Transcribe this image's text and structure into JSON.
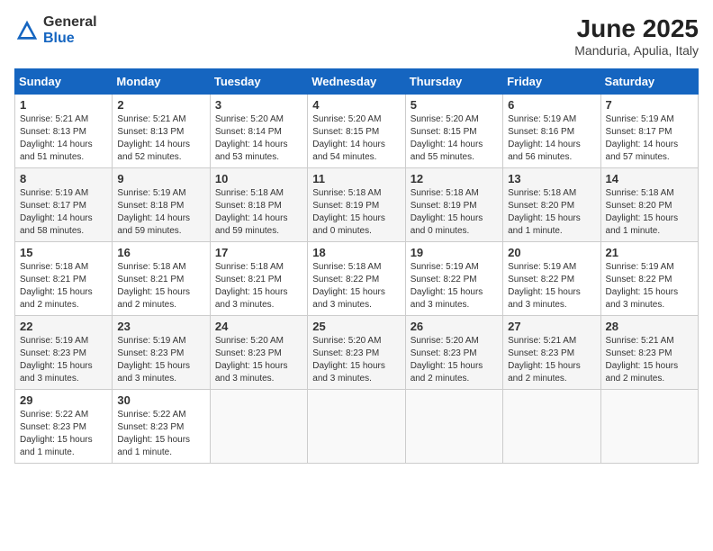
{
  "logo": {
    "text_general": "General",
    "text_blue": "Blue"
  },
  "title": "June 2025",
  "subtitle": "Manduria, Apulia, Italy",
  "days_of_week": [
    "Sunday",
    "Monday",
    "Tuesday",
    "Wednesday",
    "Thursday",
    "Friday",
    "Saturday"
  ],
  "weeks": [
    [
      {
        "day": 1,
        "sunrise": "5:21 AM",
        "sunset": "8:13 PM",
        "daylight": "14 hours and 51 minutes."
      },
      {
        "day": 2,
        "sunrise": "5:21 AM",
        "sunset": "8:13 PM",
        "daylight": "14 hours and 52 minutes."
      },
      {
        "day": 3,
        "sunrise": "5:20 AM",
        "sunset": "8:14 PM",
        "daylight": "14 hours and 53 minutes."
      },
      {
        "day": 4,
        "sunrise": "5:20 AM",
        "sunset": "8:15 PM",
        "daylight": "14 hours and 54 minutes."
      },
      {
        "day": 5,
        "sunrise": "5:20 AM",
        "sunset": "8:15 PM",
        "daylight": "14 hours and 55 minutes."
      },
      {
        "day": 6,
        "sunrise": "5:19 AM",
        "sunset": "8:16 PM",
        "daylight": "14 hours and 56 minutes."
      },
      {
        "day": 7,
        "sunrise": "5:19 AM",
        "sunset": "8:17 PM",
        "daylight": "14 hours and 57 minutes."
      }
    ],
    [
      {
        "day": 8,
        "sunrise": "5:19 AM",
        "sunset": "8:17 PM",
        "daylight": "14 hours and 58 minutes."
      },
      {
        "day": 9,
        "sunrise": "5:19 AM",
        "sunset": "8:18 PM",
        "daylight": "14 hours and 59 minutes."
      },
      {
        "day": 10,
        "sunrise": "5:18 AM",
        "sunset": "8:18 PM",
        "daylight": "14 hours and 59 minutes."
      },
      {
        "day": 11,
        "sunrise": "5:18 AM",
        "sunset": "8:19 PM",
        "daylight": "15 hours and 0 minutes."
      },
      {
        "day": 12,
        "sunrise": "5:18 AM",
        "sunset": "8:19 PM",
        "daylight": "15 hours and 0 minutes."
      },
      {
        "day": 13,
        "sunrise": "5:18 AM",
        "sunset": "8:20 PM",
        "daylight": "15 hours and 1 minute."
      },
      {
        "day": 14,
        "sunrise": "5:18 AM",
        "sunset": "8:20 PM",
        "daylight": "15 hours and 1 minute."
      }
    ],
    [
      {
        "day": 15,
        "sunrise": "5:18 AM",
        "sunset": "8:21 PM",
        "daylight": "15 hours and 2 minutes."
      },
      {
        "day": 16,
        "sunrise": "5:18 AM",
        "sunset": "8:21 PM",
        "daylight": "15 hours and 2 minutes."
      },
      {
        "day": 17,
        "sunrise": "5:18 AM",
        "sunset": "8:21 PM",
        "daylight": "15 hours and 3 minutes."
      },
      {
        "day": 18,
        "sunrise": "5:18 AM",
        "sunset": "8:22 PM",
        "daylight": "15 hours and 3 minutes."
      },
      {
        "day": 19,
        "sunrise": "5:19 AM",
        "sunset": "8:22 PM",
        "daylight": "15 hours and 3 minutes."
      },
      {
        "day": 20,
        "sunrise": "5:19 AM",
        "sunset": "8:22 PM",
        "daylight": "15 hours and 3 minutes."
      },
      {
        "day": 21,
        "sunrise": "5:19 AM",
        "sunset": "8:22 PM",
        "daylight": "15 hours and 3 minutes."
      }
    ],
    [
      {
        "day": 22,
        "sunrise": "5:19 AM",
        "sunset": "8:23 PM",
        "daylight": "15 hours and 3 minutes."
      },
      {
        "day": 23,
        "sunrise": "5:19 AM",
        "sunset": "8:23 PM",
        "daylight": "15 hours and 3 minutes."
      },
      {
        "day": 24,
        "sunrise": "5:20 AM",
        "sunset": "8:23 PM",
        "daylight": "15 hours and 3 minutes."
      },
      {
        "day": 25,
        "sunrise": "5:20 AM",
        "sunset": "8:23 PM",
        "daylight": "15 hours and 3 minutes."
      },
      {
        "day": 26,
        "sunrise": "5:20 AM",
        "sunset": "8:23 PM",
        "daylight": "15 hours and 2 minutes."
      },
      {
        "day": 27,
        "sunrise": "5:21 AM",
        "sunset": "8:23 PM",
        "daylight": "15 hours and 2 minutes."
      },
      {
        "day": 28,
        "sunrise": "5:21 AM",
        "sunset": "8:23 PM",
        "daylight": "15 hours and 2 minutes."
      }
    ],
    [
      {
        "day": 29,
        "sunrise": "5:22 AM",
        "sunset": "8:23 PM",
        "daylight": "15 hours and 1 minute."
      },
      {
        "day": 30,
        "sunrise": "5:22 AM",
        "sunset": "8:23 PM",
        "daylight": "15 hours and 1 minute."
      },
      null,
      null,
      null,
      null,
      null
    ]
  ]
}
